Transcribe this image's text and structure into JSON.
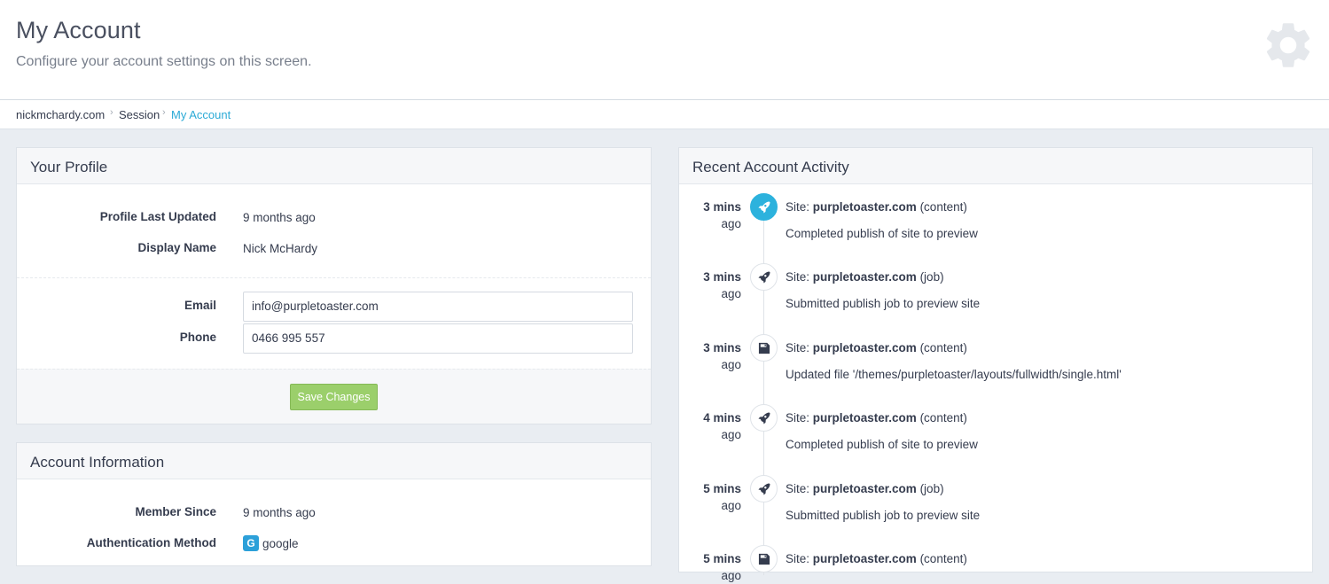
{
  "header": {
    "title": "My Account",
    "subtitle": "Configure your account settings on this screen."
  },
  "breadcrumb": [
    {
      "label": "nickmchardy.com"
    },
    {
      "label": "Session"
    },
    {
      "label": "My Account"
    }
  ],
  "profile": {
    "title": "Your Profile",
    "last_updated_label": "Profile Last Updated",
    "last_updated_value": "9 months ago",
    "display_name_label": "Display Name",
    "display_name_value": "Nick McHardy",
    "email_label": "Email",
    "email_value": "info@purpletoaster.com",
    "phone_label": "Phone",
    "phone_value": "0466 995 557",
    "save_label": "Save Changes"
  },
  "account": {
    "title": "Account Information",
    "member_since_label": "Member Since",
    "member_since_value": "9 months ago",
    "auth_label": "Authentication Method",
    "auth_icon": "G",
    "auth_value": "google"
  },
  "activity": {
    "title": "Recent Account Activity",
    "site_prefix": "Site: ",
    "items": [
      {
        "time_num": "3 mins",
        "time_unit": "ago",
        "icon": "rocket-icon",
        "site": "purpletoaster.com",
        "type": "(content)",
        "desc": "Completed publish of site to preview"
      },
      {
        "time_num": "3 mins",
        "time_unit": "ago",
        "icon": "rocket-icon",
        "site": "purpletoaster.com",
        "type": "(job)",
        "desc": "Submitted publish job to preview site"
      },
      {
        "time_num": "3 mins",
        "time_unit": "ago",
        "icon": "save-icon",
        "site": "purpletoaster.com",
        "type": "(content)",
        "desc": "Updated file '/themes/purpletoaster/layouts/fullwidth/single.html'"
      },
      {
        "time_num": "4 mins",
        "time_unit": "ago",
        "icon": "rocket-icon",
        "site": "purpletoaster.com",
        "type": "(content)",
        "desc": "Completed publish of site to preview"
      },
      {
        "time_num": "5 mins",
        "time_unit": "ago",
        "icon": "rocket-icon",
        "site": "purpletoaster.com",
        "type": "(job)",
        "desc": "Submitted publish job to preview site"
      },
      {
        "time_num": "5 mins",
        "time_unit": "ago",
        "icon": "save-icon",
        "site": "purpletoaster.com",
        "type": "(content)",
        "desc": ""
      }
    ]
  },
  "colors": {
    "accent": "#2cb2dd",
    "save_button": "#9bcf6b"
  }
}
